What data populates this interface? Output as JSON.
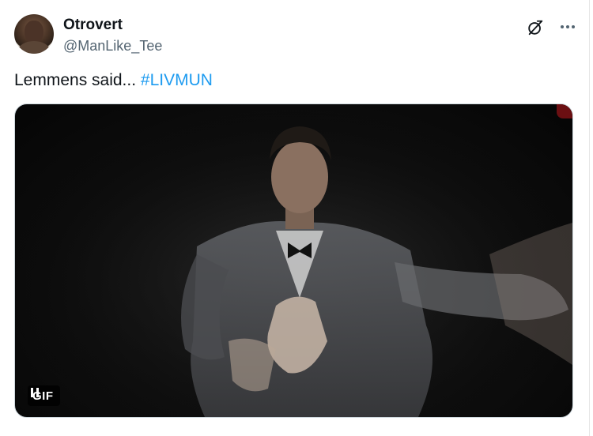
{
  "author": {
    "display_name": "Otrovert",
    "handle": "@ManLike_Tee"
  },
  "tweet": {
    "text": "Lemmens said...",
    "hashtag": "#LIVMUN"
  },
  "media": {
    "type": "gif",
    "badge_label": "GIF",
    "state": "playing"
  },
  "icons": {
    "grok": "grok-icon",
    "more": "more-icon",
    "pause": "pause-icon"
  },
  "colors": {
    "link": "#1d9bf0",
    "text": "#0f1419",
    "secondary": "#536471"
  }
}
